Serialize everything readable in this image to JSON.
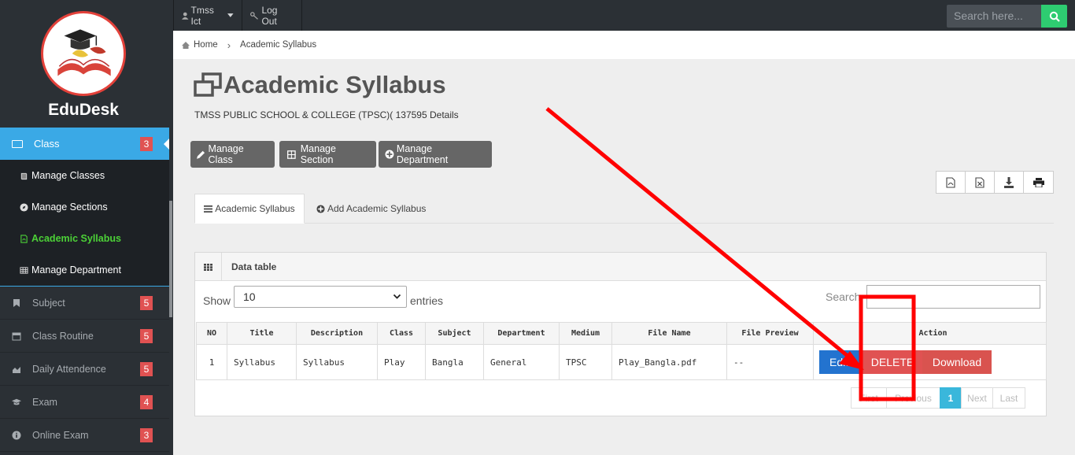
{
  "brand": "EduDesk",
  "sidebar": {
    "active": {
      "label": "Class",
      "badge": "3"
    },
    "submenu": [
      {
        "label": "Manage Classes"
      },
      {
        "label": "Manage Sections"
      },
      {
        "label": "Academic Syllabus"
      },
      {
        "label": "Manage Department"
      }
    ],
    "items": [
      {
        "label": "Subject",
        "badge": "5"
      },
      {
        "label": "Class Routine",
        "badge": "5"
      },
      {
        "label": "Daily Attendence",
        "badge": "5"
      },
      {
        "label": "Exam",
        "badge": "4"
      },
      {
        "label": "Online Exam",
        "badge": "3"
      }
    ]
  },
  "topbar": {
    "user": "Tmss Ict",
    "logout": "Log Out",
    "search_placeholder": "Search here..."
  },
  "breadcrumb": {
    "home": "Home",
    "current": "Academic Syllabus"
  },
  "page": {
    "title": "Academic Syllabus",
    "subtitle": "TMSS PUBLIC SCHOOL & COLLEGE (TPSC)( 137595 Details"
  },
  "actions": {
    "manage_class": "Manage Class",
    "manage_section": "Manage Section",
    "manage_department": "Manage Department"
  },
  "tabs": {
    "list": "Academic Syllabus",
    "add": "Add Academic Syllabus"
  },
  "panel": {
    "title": "Data table",
    "show": "Show",
    "page_size": "10",
    "entries": "entries",
    "search": "Search:"
  },
  "table": {
    "headers": [
      "NO",
      "Title",
      "Description",
      "Class",
      "Subject",
      "Department",
      "Medium",
      "File Name",
      "File Preview",
      "Action"
    ],
    "rows": [
      [
        "1",
        "Syllabus",
        "Syllabus",
        "Play",
        "Bangla",
        "General",
        "TPSC",
        "Play_Bangla.pdf",
        "--"
      ]
    ],
    "row_actions": {
      "edit": "Edit",
      "delete": "DELETE",
      "download": "Download"
    }
  },
  "pagination": {
    "first": "First",
    "previous": "Previous",
    "current": "1",
    "next": "Next",
    "last": "Last"
  },
  "colors": {
    "accent": "#3aa9e6",
    "badge": "#e05252",
    "edit": "#2373cf",
    "delete": "#e05252",
    "annotation": "#ff0000"
  }
}
